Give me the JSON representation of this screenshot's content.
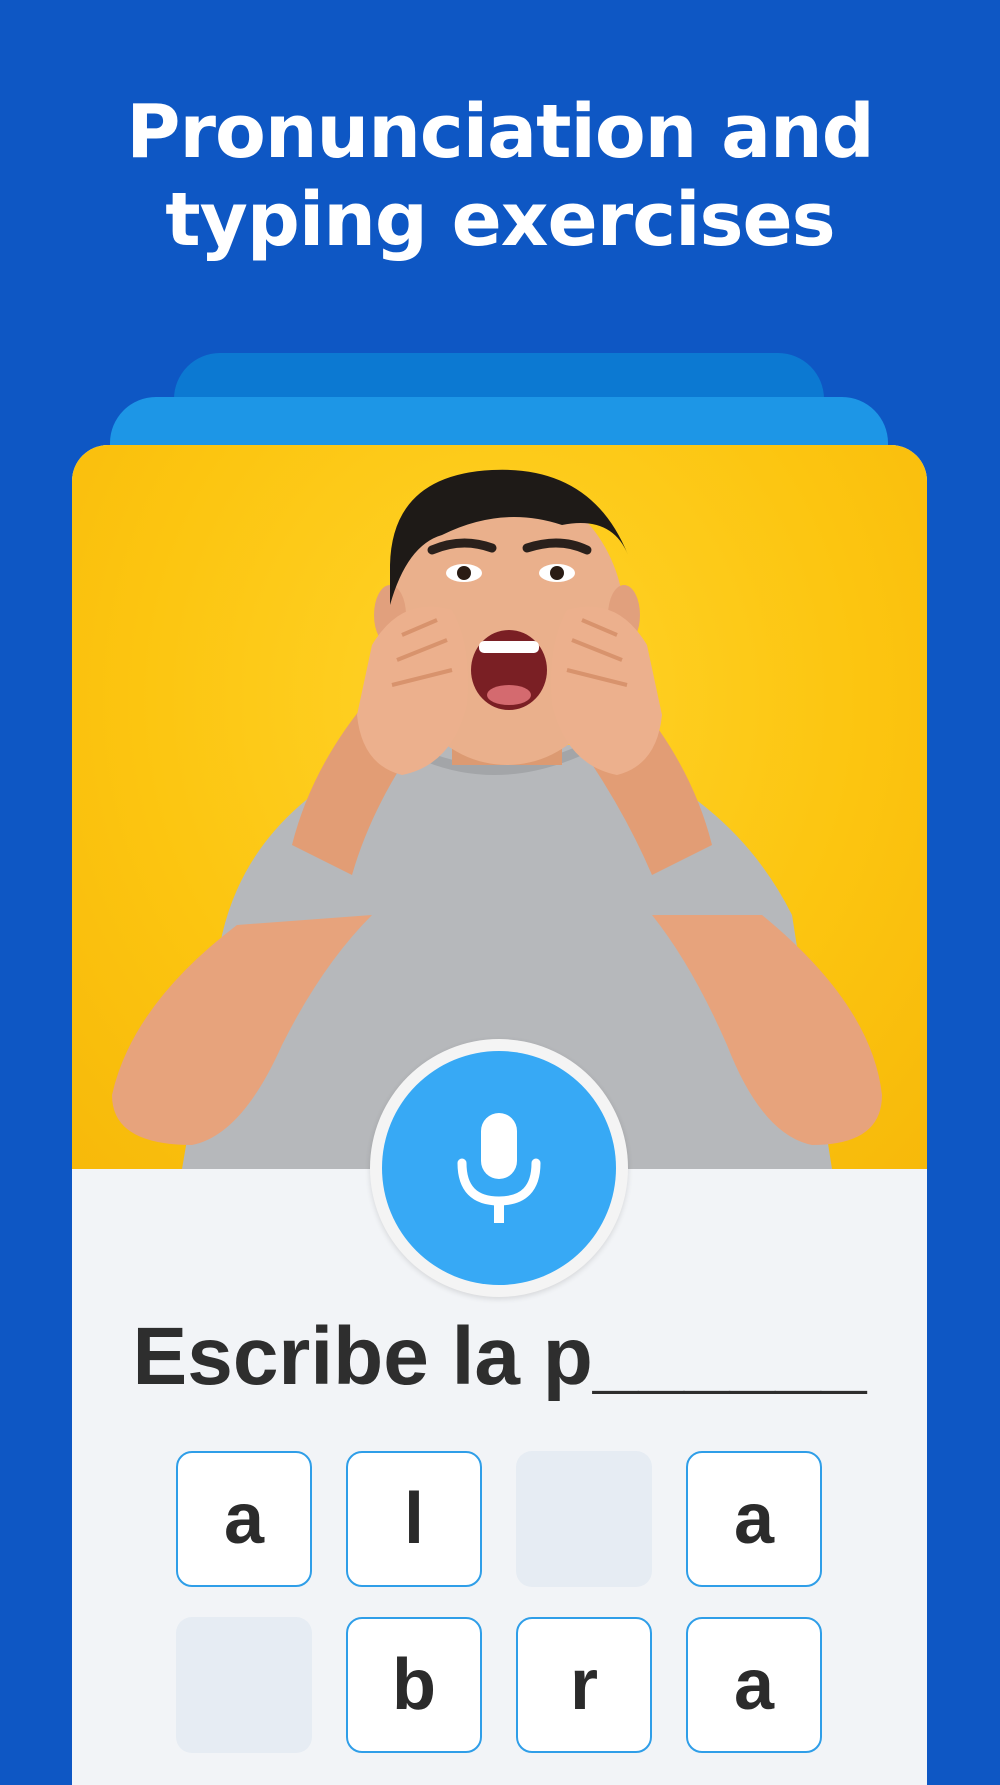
{
  "headline": {
    "line1": "Pronunciation and",
    "line2": "typing exercises"
  },
  "card": {
    "photo_alt": "Man shouting with hands cupped around mouth",
    "mic_icon": "microphone-icon",
    "prompt": "Escribe la p______"
  },
  "tiles": [
    {
      "letter": "a",
      "state": "filled"
    },
    {
      "letter": "l",
      "state": "filled"
    },
    {
      "letter": "",
      "state": "empty"
    },
    {
      "letter": "a",
      "state": "filled"
    },
    {
      "letter": "",
      "state": "empty"
    },
    {
      "letter": "b",
      "state": "filled"
    },
    {
      "letter": "r",
      "state": "filled"
    },
    {
      "letter": "a",
      "state": "filled"
    }
  ],
  "colors": {
    "background": "#0e57c4",
    "photo_bg": "#fcc510",
    "mic": "#37a9f5",
    "tile_border": "#2f9ee8"
  }
}
